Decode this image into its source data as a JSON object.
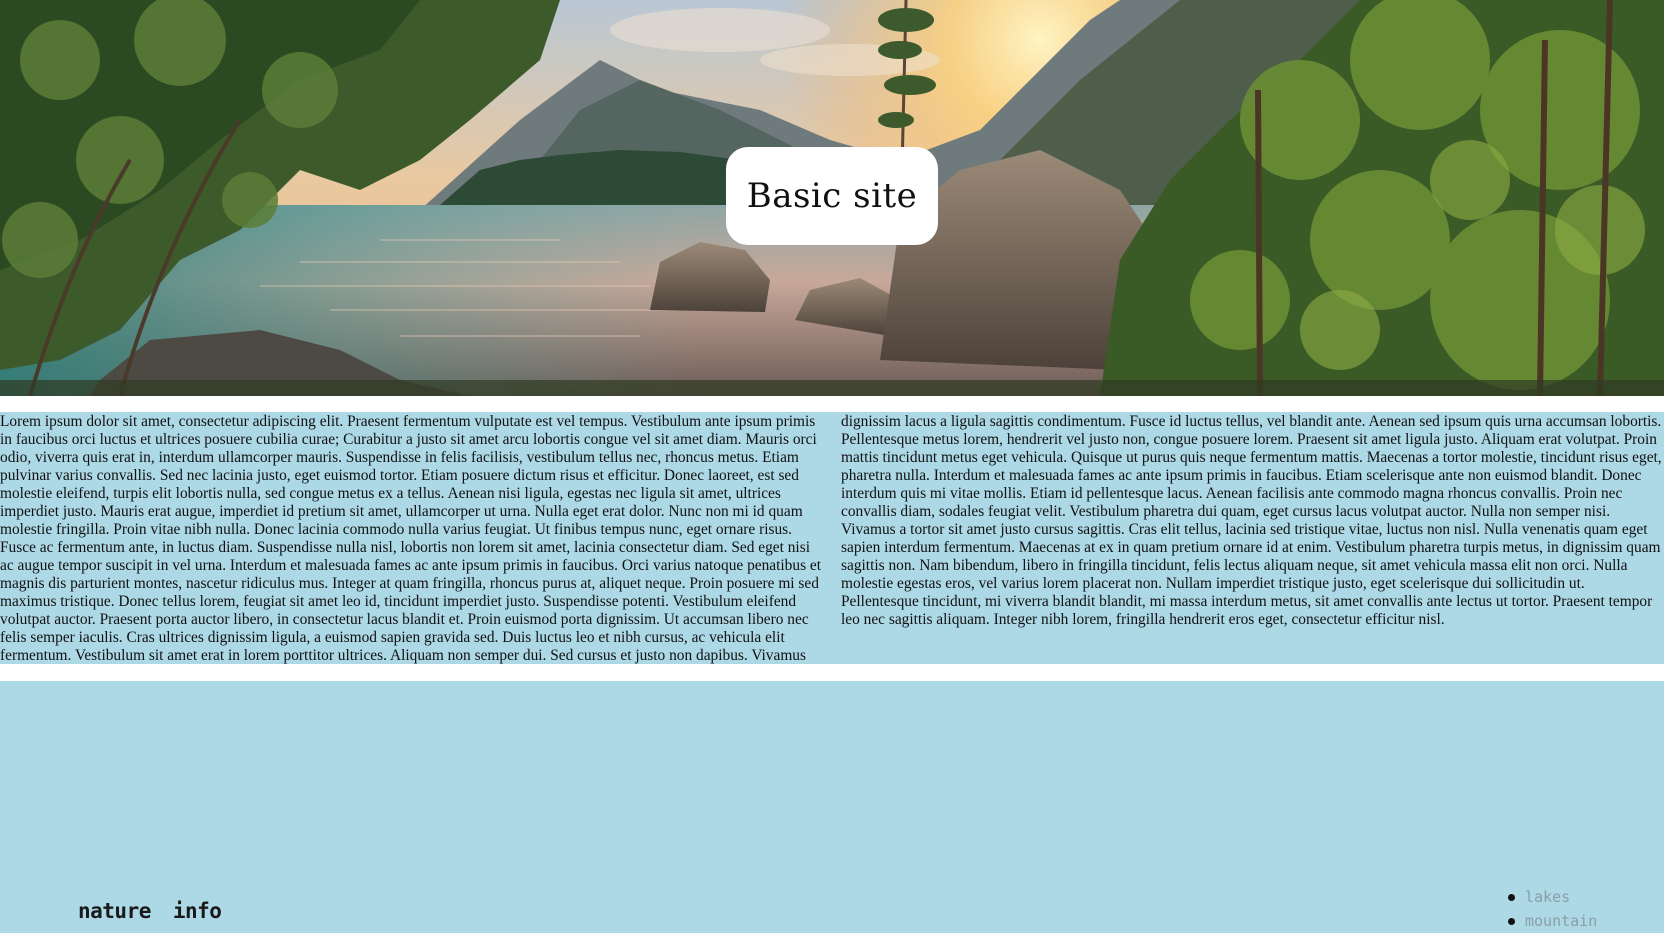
{
  "hero": {
    "title": "Basic site",
    "image_description_icon": "landscape-image"
  },
  "article": {
    "text": "Lorem ipsum dolor sit amet, consectetur adipiscing elit. Praesent fermentum vulputate est vel tempus. Vestibulum ante ipsum primis in faucibus orci luctus et ultrices posuere cubilia curae; Curabitur a justo sit amet arcu lobortis congue vel sit amet diam. Mauris orci odio, viverra quis erat in, interdum ullamcorper mauris. Suspendisse in felis facilisis, vestibulum tellus nec, rhoncus metus. Etiam pulvinar varius convallis. Sed nec lacinia justo, eget euismod tortor. Etiam posuere dictum risus et efficitur. Donec laoreet, est sed molestie eleifend, turpis elit lobortis nulla, sed congue metus ex a tellus. Aenean nisi ligula, egestas nec ligula sit amet, ultrices imperdiet justo. Mauris erat augue, imperdiet id pretium sit amet, ullamcorper ut urna. Nulla eget erat dolor. Nunc non mi id quam molestie fringilla. Proin vitae nibh nulla. Donec lacinia commodo nulla varius feugiat. Ut finibus tempus nunc, eget ornare risus. Fusce ac fermentum ante, in luctus diam. Suspendisse nulla nisl, lobortis non lorem sit amet, lacinia consectetur diam. Sed eget nisi ac augue tempor suscipit in vel urna. Interdum et malesuada fames ac ante ipsum primis in faucibus. Orci varius natoque penatibus et magnis dis parturient montes, nascetur ridiculus mus. Integer at quam fringilla, rhoncus purus at, aliquet neque. Proin posuere mi sed maximus tristique. Donec tellus lorem, feugiat sit amet leo id, tincidunt imperdiet justo. Suspendisse potenti. Vestibulum eleifend volutpat auctor. Praesent porta auctor libero, in consectetur lacus blandit et. Proin euismod porta dignissim. Ut accumsan libero nec felis semper iaculis. Cras ultrices dignissim ligula, a euismod sapien gravida sed. Duis luctus leo et nibh cursus, ac vehicula elit fermentum. Vestibulum sit amet erat in lorem porttitor ultrices. Aliquam non semper dui. Sed cursus et justo non dapibus. Vivamus dignissim lacus a ligula sagittis condimentum. Fusce id luctus tellus, vel blandit ante. Aenean sed ipsum quis urna accumsan lobortis. Pellentesque metus lorem, hendrerit vel justo non, congue posuere lorem. Praesent sit amet ligula justo. Aliquam erat volutpat. Proin mattis tincidunt metus eget vehicula. Quisque ut purus quis neque fermentum mattis. Maecenas a tortor molestie, tincidunt risus eget, pharetra nulla. Interdum et malesuada fames ac ante ipsum primis in faucibus. Etiam scelerisque ante non euismod blandit. Donec interdum quis mi vitae mollis. Etiam id pellentesque lacus. Aenean facilisis ante commodo magna rhoncus convallis. Proin nec convallis diam, sodales feugiat velit. Vestibulum pharetra dui quam, eget cursus lacus volutpat auctor. Nulla non semper nisi. Vivamus a tortor sit amet justo cursus sagittis. Cras elit tellus, lacinia sed tristique vitae, luctus non nisl. Nulla venenatis quam eget sapien interdum fermentum. Maecenas at ex in quam pretium ornare id at enim. Vestibulum pharetra turpis metus, in dignissim quam sagittis non. Nam bibendum, libero in fringilla tincidunt, felis lectus aliquam neque, sit amet vehicula massa elit non orci. Nulla molestie egestas eros, vel varius lorem placerat non. Nullam imperdiet tristique justo, eget scelerisque dui sollicitudin ut. Pellentesque tincidunt, mi viverra blandit blandit, mi massa interdum metus, sit amet convallis ante lectus ut tortor. Praesent tempor leo nec sagittis aliquam. Integer nibh lorem, fringilla hendrerit eros eget, consectetur efficitur nisl."
  },
  "footer": {
    "nav": [
      {
        "label": "nature"
      },
      {
        "label": "info"
      }
    ],
    "list": [
      {
        "label": "lakes"
      },
      {
        "label": "mountain"
      }
    ]
  },
  "colors": {
    "content_background": "#add8e6",
    "title_card_background": "#ffffff",
    "link_muted": "#8a9ea6"
  }
}
